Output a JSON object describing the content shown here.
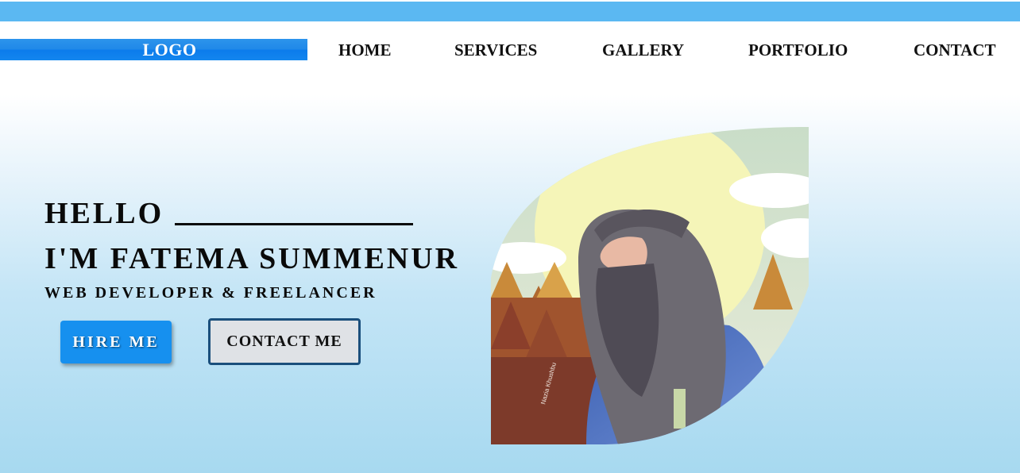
{
  "header": {
    "logo": "LOGO",
    "nav": [
      "HOME",
      "SERVICES",
      "GALLERY",
      "PORTFOLIO",
      "CONTACT"
    ]
  },
  "hero": {
    "greeting": "HELLO",
    "name": "I'M FATEMA SUMMENUR",
    "subtitle": "WEB DEVELOPER & FREELANCER",
    "hire_button": "HIRE ME",
    "contact_button": "CONTACT ME",
    "image_signature": "Nazia Khushbu"
  },
  "colors": {
    "topbar": "#5bb8f2",
    "logo_bg": "#1786ee",
    "hire_bg": "#1690ef",
    "contact_border": "#1a4f7c"
  },
  "icons": {
    "portrait": "illustrated-portrait"
  }
}
